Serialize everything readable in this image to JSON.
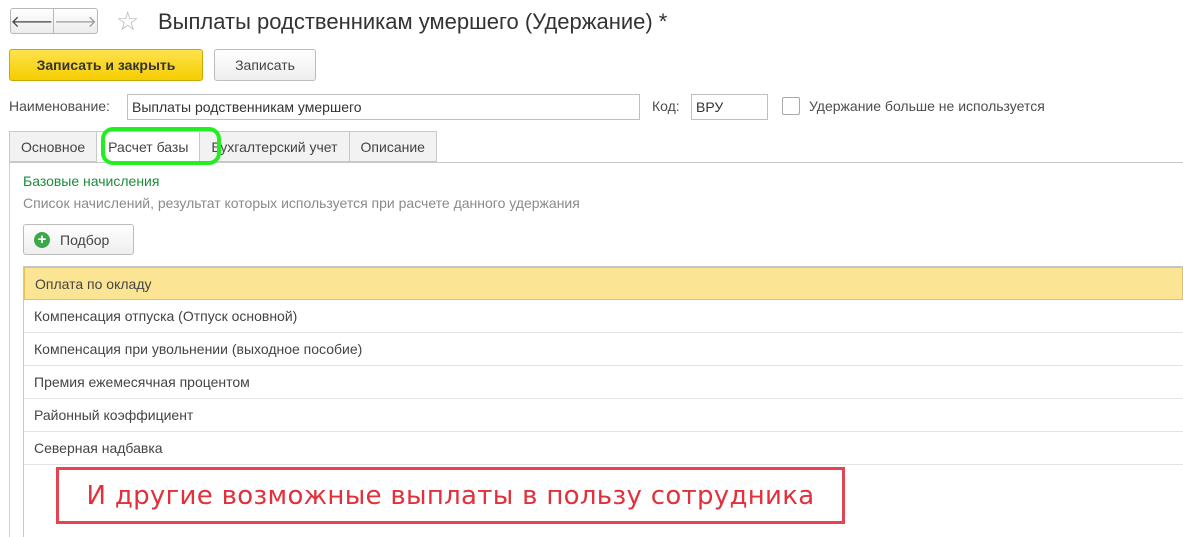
{
  "window": {
    "title": "Выплаты родственникам умершего (Удержание) *",
    "back_glyph": "🡐",
    "forward_glyph": "🡒",
    "star_glyph": "☆"
  },
  "toolbar": {
    "save_close_label": "Записать и закрыть",
    "save_label": "Записать"
  },
  "form": {
    "name_label": "Наименование:",
    "name_value": "Выплаты родственникам умершего",
    "code_label": "Код:",
    "code_value": "ВРУ",
    "unused_label": "Удержание больше не используется",
    "unused_checked": false
  },
  "tabs": [
    {
      "label": "Основное",
      "active": false
    },
    {
      "label": "Расчет базы",
      "active": true
    },
    {
      "label": "Бухгалтерский учет",
      "active": false
    },
    {
      "label": "Описание",
      "active": false
    }
  ],
  "section": {
    "title": "Базовые начисления",
    "description": "Список начислений, результат которых используется при расчете данного удержания",
    "pick_button_label": "Подбор",
    "pick_icon": "+"
  },
  "accruals": [
    "Оплата по окладу",
    "Компенсация отпуска (Отпуск основной)",
    "Компенсация при увольнении (выходное пособие)",
    "Премия ежемесячная процентом",
    "Районный коэффициент",
    "Северная надбавка"
  ],
  "selected_row": 0,
  "annotation": {
    "text": "И другие возможные выплаты в пользу сотрудника",
    "color": "#e2303c"
  },
  "colors": {
    "primary_button": "#f5cd00",
    "highlight_ring": "#22ee22",
    "section_title": "#1d8c3b",
    "selected_row": "#fbe594"
  }
}
